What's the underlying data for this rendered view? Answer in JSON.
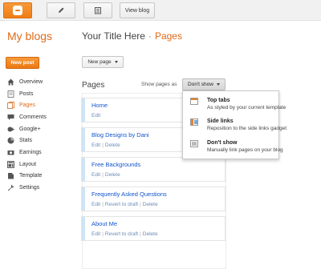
{
  "topbar": {
    "view_blog_label": "View blog"
  },
  "sidebar": {
    "title": "My blogs",
    "new_post_label": "New post",
    "items": [
      {
        "label": "Overview",
        "icon": "home-icon",
        "active": false
      },
      {
        "label": "Posts",
        "icon": "posts-icon",
        "active": false
      },
      {
        "label": "Pages",
        "icon": "pages-icon",
        "active": true
      },
      {
        "label": "Comments",
        "icon": "comment-icon",
        "active": false
      },
      {
        "label": "Google+",
        "icon": "google-plus-icon",
        "active": false
      },
      {
        "label": "Stats",
        "icon": "stats-icon",
        "active": false
      },
      {
        "label": "Earnings",
        "icon": "earnings-icon",
        "active": false
      },
      {
        "label": "Layout",
        "icon": "layout-icon",
        "active": false
      },
      {
        "label": "Template",
        "icon": "template-icon",
        "active": false
      },
      {
        "label": "Settings",
        "icon": "wrench-icon",
        "active": false
      }
    ]
  },
  "header": {
    "blog_title": "Your Title Here",
    "separator": "·",
    "section": "Pages"
  },
  "toolbar": {
    "new_page_label": "New page"
  },
  "pages_section": {
    "heading": "Pages",
    "show_as_label": "Show pages as",
    "selected_option": "Don't show"
  },
  "pages": [
    {
      "name": "Home",
      "actions": [
        "Edit"
      ]
    },
    {
      "name": "Blog Designs by Dani",
      "actions": [
        "Edit",
        "Delete"
      ]
    },
    {
      "name": "Free Backgrounds",
      "actions": [
        "Edit",
        "Delete"
      ]
    },
    {
      "name": "Frequently Asked Questions",
      "actions": [
        "Edit",
        "Revert to draft",
        "Delete"
      ]
    },
    {
      "name": "About Me",
      "actions": [
        "Edit",
        "Revert to draft",
        "Delete"
      ]
    }
  ],
  "dropdown": {
    "options": [
      {
        "title": "Top tabs",
        "description": "As styled by your current template",
        "icon": "top-tabs-icon"
      },
      {
        "title": "Side links",
        "description": "Reposition to the side links gadget",
        "icon": "side-links-icon"
      },
      {
        "title": "Don't show",
        "description": "Manually link pages on your blog",
        "icon": "dont-show-icon"
      }
    ]
  },
  "colors": {
    "accent": "#dd6b1a",
    "link": "#1155cc",
    "page_bar": "#cfe4f5"
  }
}
